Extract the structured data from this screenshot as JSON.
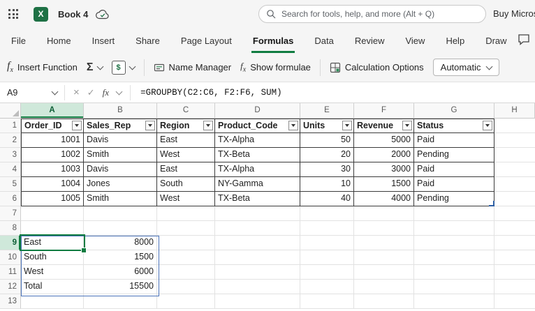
{
  "topbar": {
    "workbook_title": "Book 4",
    "search_placeholder": "Search for tools, help, and more (Alt + Q)",
    "buy_label": "Buy Microso"
  },
  "menu": {
    "tabs": [
      "File",
      "Home",
      "Insert",
      "Share",
      "Page Layout",
      "Formulas",
      "Data",
      "Review",
      "View",
      "Help",
      "Draw"
    ],
    "active_tab": "Formulas"
  },
  "ribbon": {
    "fx_glyph": "f",
    "fx_sub": "x",
    "insert_function_label": "Insert Function",
    "autosum_glyph": "Σ",
    "financial_glyph": "$",
    "name_manager_label": "Name Manager",
    "show_formulae_label": "Show formulae",
    "calculation_options_label": "Calculation Options",
    "calc_mode_value": "Automatic"
  },
  "formula_bar": {
    "name_box": "A9",
    "cancel_glyph": "×",
    "enter_glyph": "✓",
    "fx_glyph": "fx",
    "formula": "=GROUPBY(C2:C6, F2:F6, SUM)"
  },
  "sheet": {
    "column_headers": [
      "A",
      "B",
      "C",
      "D",
      "E",
      "F",
      "G",
      "H"
    ],
    "row_headers": [
      "1",
      "2",
      "3",
      "4",
      "5",
      "6",
      "7",
      "8",
      "9",
      "10",
      "11",
      "12",
      "13"
    ],
    "selected_cell": "A9",
    "table": {
      "headers": [
        "Order_ID",
        "Sales_Rep",
        "Region",
        "Product_Code",
        "Units",
        "Revenue",
        "Status"
      ],
      "rows": [
        [
          "1001",
          "Davis",
          "East",
          "TX-Alpha",
          "50",
          "5000",
          "Paid"
        ],
        [
          "1002",
          "Smith",
          "West",
          "TX-Beta",
          "20",
          "2000",
          "Pending"
        ],
        [
          "1003",
          "Davis",
          "East",
          "TX-Alpha",
          "30",
          "3000",
          "Paid"
        ],
        [
          "1004",
          "Jones",
          "South",
          "NY-Gamma",
          "10",
          "1500",
          "Paid"
        ],
        [
          "1005",
          "Smith",
          "West",
          "TX-Beta",
          "40",
          "4000",
          "Pending"
        ]
      ]
    },
    "spill": {
      "rows": [
        [
          "East",
          "8000"
        ],
        [
          "South",
          "1500"
        ],
        [
          "West",
          "6000"
        ],
        [
          "Total",
          "15500"
        ]
      ]
    }
  },
  "colors": {
    "excel_green": "#107C41",
    "header_selected_bg": "#CFE8DA",
    "table_border": "#3B3B3B",
    "spill_border": "#4A72B8"
  }
}
